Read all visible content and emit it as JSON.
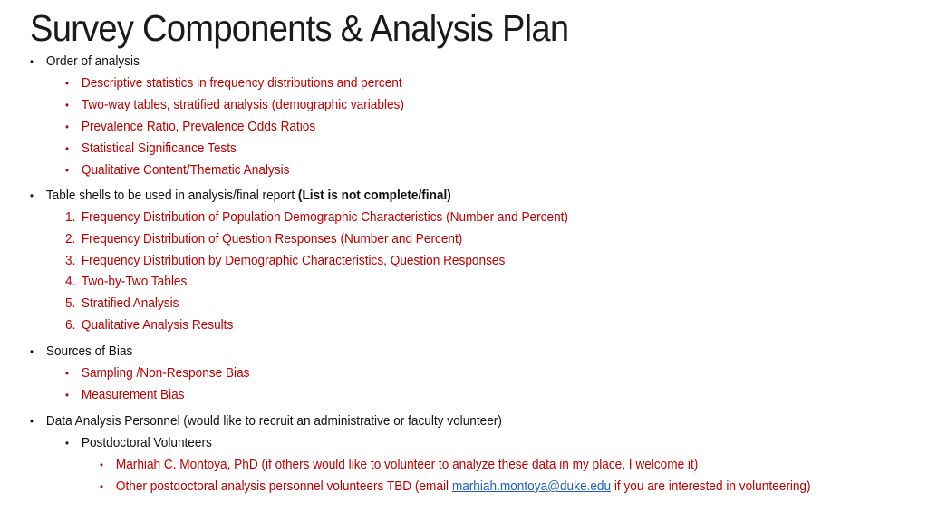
{
  "title": "Survey Components & Analysis Plan",
  "bullet_glyph": "•",
  "sections": {
    "order": {
      "heading": "Order of analysis",
      "items": [
        "Descriptive statistics in frequency distributions and percent",
        "Two-way tables, stratified analysis (demographic variables)",
        "Prevalence Ratio, Prevalence Odds Ratios",
        "Statistical Significance Tests",
        "Qualitative Content/Thematic Analysis"
      ]
    },
    "tables": {
      "heading": "Table shells to be used in analysis/final report ",
      "heading_bold": "(List is not complete/final)",
      "items": [
        {
          "num": "1.",
          "text": "Frequency Distribution of Population Demographic Characteristics (Number and Percent)"
        },
        {
          "num": "2.",
          "text": "Frequency Distribution of Question Responses (Number and Percent)"
        },
        {
          "num": "3.",
          "text": "Frequency Distribution by Demographic Characteristics, Question Responses"
        },
        {
          "num": "4.",
          "text": "Two-by-Two Tables"
        },
        {
          "num": "5.",
          "text": "Stratified Analysis"
        },
        {
          "num": "6.",
          "text": "Qualitative Analysis Results"
        }
      ]
    },
    "bias": {
      "heading": "Sources of Bias",
      "items": [
        "Sampling /Non-Response Bias",
        "Measurement Bias"
      ]
    },
    "personnel": {
      "heading": "Data Analysis Personnel (would like to recruit an administrative or faculty volunteer)",
      "sub_heading": "Postdoctoral Volunteers",
      "items": [
        {
          "text": "Marhiah C. Montoya, PhD (if others would like to volunteer to analyze these data in my place, I welcome it)"
        },
        {
          "text_before": "Other postdoctoral analysis personnel volunteers TBD (email ",
          "link": "marhiah.montoya@duke.edu",
          "text_after": " if you are interested in volunteering)"
        }
      ]
    }
  },
  "colors": {
    "accent_red": "#c00000",
    "body_text": "#111111",
    "link": "#1f5fbf"
  }
}
